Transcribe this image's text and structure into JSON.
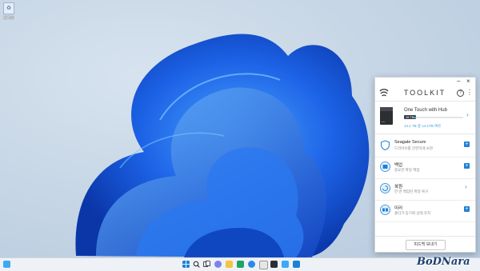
{
  "desktop": {
    "recycle_bin_label": "휴지통"
  },
  "toolkit": {
    "title": "TOOLKIT",
    "help_symbol": "?",
    "more_symbol": "⋮",
    "minimize_symbol": "–",
    "close_symbol": "×",
    "device": {
      "name": "One Touch with Hub",
      "capacity_badge": "16 TB",
      "used_fraction": 0.05,
      "space_text": "14.1 TB 중 14.1TB 여유"
    },
    "rows": [
      {
        "title": "Seagate Secure",
        "subtitle": "드라이브를 안전하게 보관",
        "action": "plus",
        "icon": "shield-icon"
      },
      {
        "title": "백업",
        "subtitle": "중요한 파일 백업",
        "action": "plus",
        "icon": "backup-icon"
      },
      {
        "title": "복원",
        "subtitle": "한 번 백업된 파일 복구",
        "action": "chevron",
        "icon": "restore-icon"
      },
      {
        "title": "미러",
        "subtitle": "폴더가 동기화 상태 유지",
        "action": "plus",
        "icon": "mirror-icon"
      }
    ],
    "feedback_label": "피드백 보내기"
  },
  "watermark": "BoDNara",
  "colors": {
    "accent": "#1f80d6",
    "bloom_dark": "#0b3fb8",
    "bloom_light": "#3a8cf5",
    "taskbar": "#eef2f7"
  }
}
